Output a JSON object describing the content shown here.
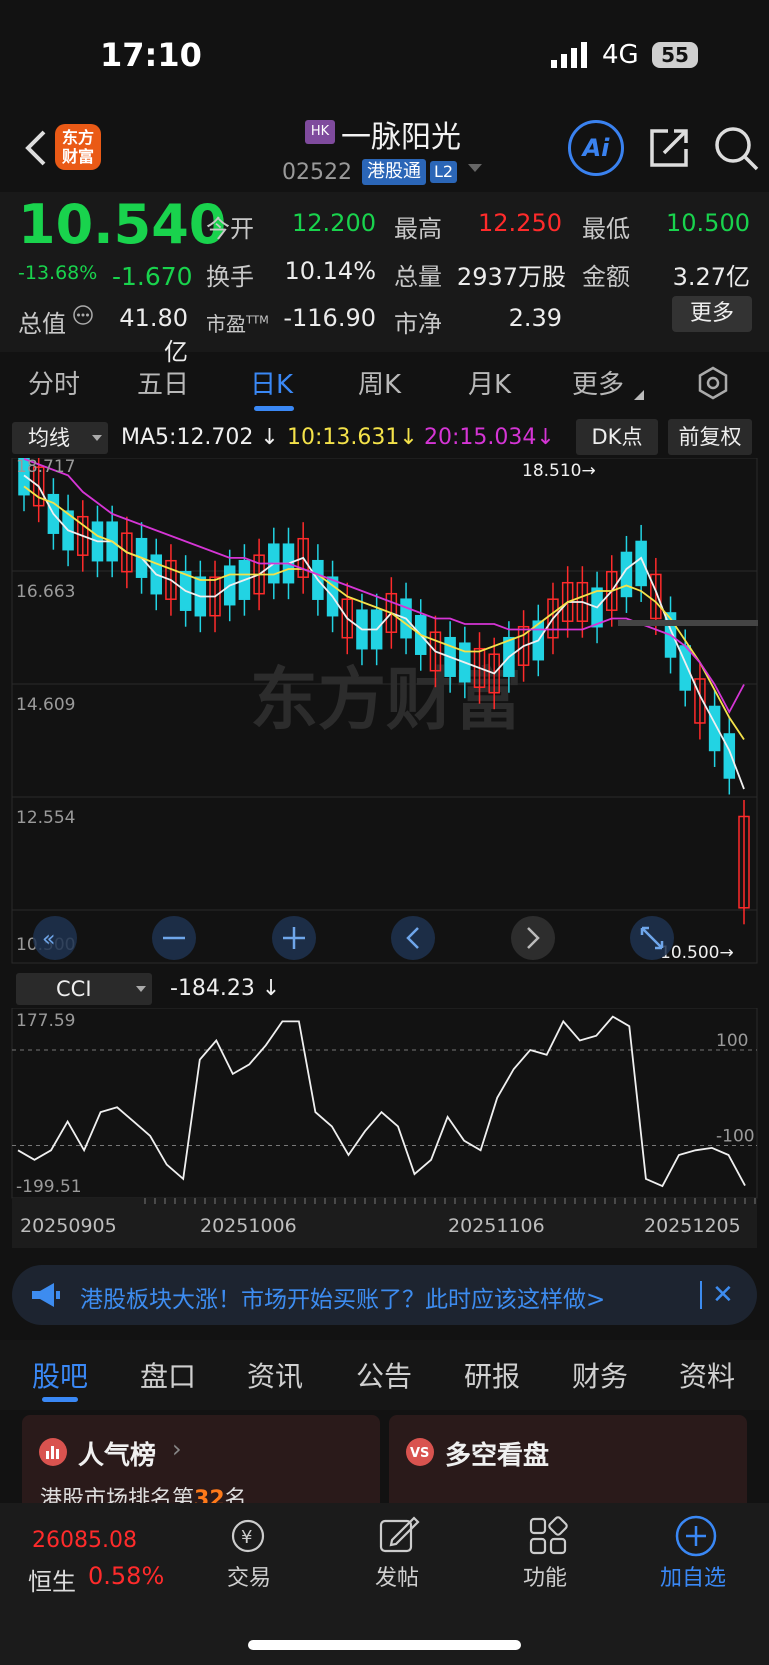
{
  "status_bar": {
    "time": "17:10",
    "network": "4G",
    "battery": "55"
  },
  "header": {
    "logo_line1": "东方",
    "logo_line2": "财富",
    "market_badge": "HK",
    "stock_name": "一脉阳光",
    "stock_code": "02522",
    "connect_badge": "港股通",
    "level_badge": "L2",
    "ai_label": "Ai"
  },
  "quote": {
    "price": "10.540",
    "change_pct": "-13.68%",
    "change_abs": "-1.670",
    "open_label": "今开",
    "open": "12.200",
    "high_label": "最高",
    "high": "12.250",
    "low_label": "最低",
    "low": "10.500",
    "turnover_label": "换手",
    "turnover": "10.14%",
    "volume_label": "总量",
    "volume": "2937万股",
    "amount_label": "金额",
    "amount": "3.27亿",
    "mktcap_label": "总值",
    "mktcap": "41.80亿",
    "pe_label": "市盈",
    "pe_sup": "TTM",
    "pe": "-116.90",
    "pb_label": "市净",
    "pb": "2.39",
    "more_label": "更多"
  },
  "period_tabs": [
    "分时",
    "五日",
    "日K",
    "周K",
    "月K",
    "更多"
  ],
  "indicators": {
    "ma_select": "均线",
    "ma5": "MA5:12.702",
    "ma10": "10:13.631",
    "ma20": "20:15.034",
    "dk_label": "DK点",
    "adjust_label": "前复权",
    "cci_select": "CCI",
    "cci_value": "-184.23"
  },
  "colors": {
    "up": "#ff2b2b",
    "down": "#19d34d",
    "candle_down": "#22d3e3",
    "ma5": "#f0f0f0",
    "ma10": "#f4e24a",
    "ma20": "#d535d5",
    "accent": "#3a88f5"
  },
  "chart_data": [
    {
      "type": "candlestick",
      "y_ticks": [
        "18.717",
        "16.663",
        "14.609",
        "12.554",
        "10.500"
      ],
      "ylim": [
        10.5,
        18.717
      ],
      "high_marker": "18.510",
      "low_marker": "10.500",
      "watermark": "东方财富",
      "series": [
        {
          "name": "MA5",
          "values": [
            18.4,
            18.2,
            17.7,
            17.4,
            17.3,
            17.2,
            17.2,
            17.0,
            16.9,
            16.6,
            16.5,
            16.3,
            16.2,
            16.2,
            16.4,
            16.5,
            16.6,
            16.8,
            16.8,
            16.9,
            16.5,
            16.2,
            15.8,
            15.6,
            15.6,
            15.9,
            15.8,
            15.5,
            15.2,
            15.1,
            15.0,
            14.9,
            14.8,
            15.1,
            15.3,
            15.4,
            15.8,
            16.1,
            16.1,
            16.0,
            16.3,
            16.7,
            16.9,
            16.3,
            15.6,
            15.0,
            14.4,
            13.9,
            13.4,
            12.7
          ]
        },
        {
          "name": "10",
          "values": [
            18.2,
            18.0,
            17.9,
            17.7,
            17.5,
            17.3,
            17.2,
            17.0,
            16.9,
            16.8,
            16.7,
            16.6,
            16.5,
            16.5,
            16.6,
            16.6,
            16.6,
            16.6,
            16.7,
            16.7,
            16.6,
            16.4,
            16.2,
            16.1,
            16.0,
            15.9,
            15.7,
            15.5,
            15.4,
            15.3,
            15.2,
            15.2,
            15.3,
            15.4,
            15.5,
            15.7,
            15.9,
            16.1,
            16.2,
            16.3,
            16.3,
            16.4,
            16.3,
            16.1,
            15.8,
            15.4,
            15.0,
            14.5,
            14.0,
            13.6
          ]
        },
        {
          "name": "20",
          "values": [
            18.7,
            18.6,
            18.5,
            18.4,
            18.1,
            17.9,
            17.7,
            17.6,
            17.5,
            17.4,
            17.3,
            17.2,
            17.1,
            17.0,
            16.9,
            16.9,
            16.8,
            16.8,
            16.8,
            16.7,
            16.6,
            16.5,
            16.4,
            16.3,
            16.2,
            16.1,
            16.0,
            15.9,
            15.8,
            15.8,
            15.7,
            15.7,
            15.7,
            15.6,
            15.6,
            15.6,
            15.6,
            15.6,
            15.6,
            15.7,
            15.8,
            15.8,
            15.7,
            15.6,
            15.5,
            15.3,
            15.0,
            14.6,
            14.1,
            14.6
          ]
        }
      ]
    },
    {
      "type": "line",
      "title": "CCI",
      "y_ticks": [
        "177.59",
        "-199.51"
      ],
      "ylim": [
        -199.51,
        177.59
      ],
      "reference_lines": [
        "100",
        "-100"
      ],
      "x_labels": [
        "20250905",
        "20251006",
        "20251106",
        "20251205"
      ],
      "values": [
        -110,
        -130,
        -110,
        -50,
        -110,
        -30,
        -20,
        -50,
        -80,
        -140,
        -170,
        80,
        120,
        50,
        70,
        110,
        160,
        160,
        -30,
        -60,
        -120,
        -70,
        -30,
        -60,
        -160,
        -130,
        -40,
        -90,
        -110,
        0,
        60,
        100,
        90,
        160,
        120,
        130,
        170,
        150,
        -170,
        -185,
        -120,
        -110,
        -105,
        -120,
        -184
      ],
      "series_name": "CCI"
    }
  ],
  "news_banner": {
    "text": "港股板块大涨！市场开始买账了？此时应该这样做>"
  },
  "content_tabs": [
    "股吧",
    "盘口",
    "资讯",
    "公告",
    "研报",
    "财务",
    "资料"
  ],
  "cards": {
    "popular_title": "人气榜",
    "popular_sub_prefix": "港股市场排名第",
    "popular_rank": "32",
    "popular_sub_suffix": "名",
    "bullbear_title": "多空看盘"
  },
  "bottom_nav": {
    "index_value": "26085.08",
    "index_name": "恒生",
    "index_change": "0.58%",
    "trade": "交易",
    "post": "发帖",
    "functions": "功能",
    "watchlist": "加自选"
  }
}
